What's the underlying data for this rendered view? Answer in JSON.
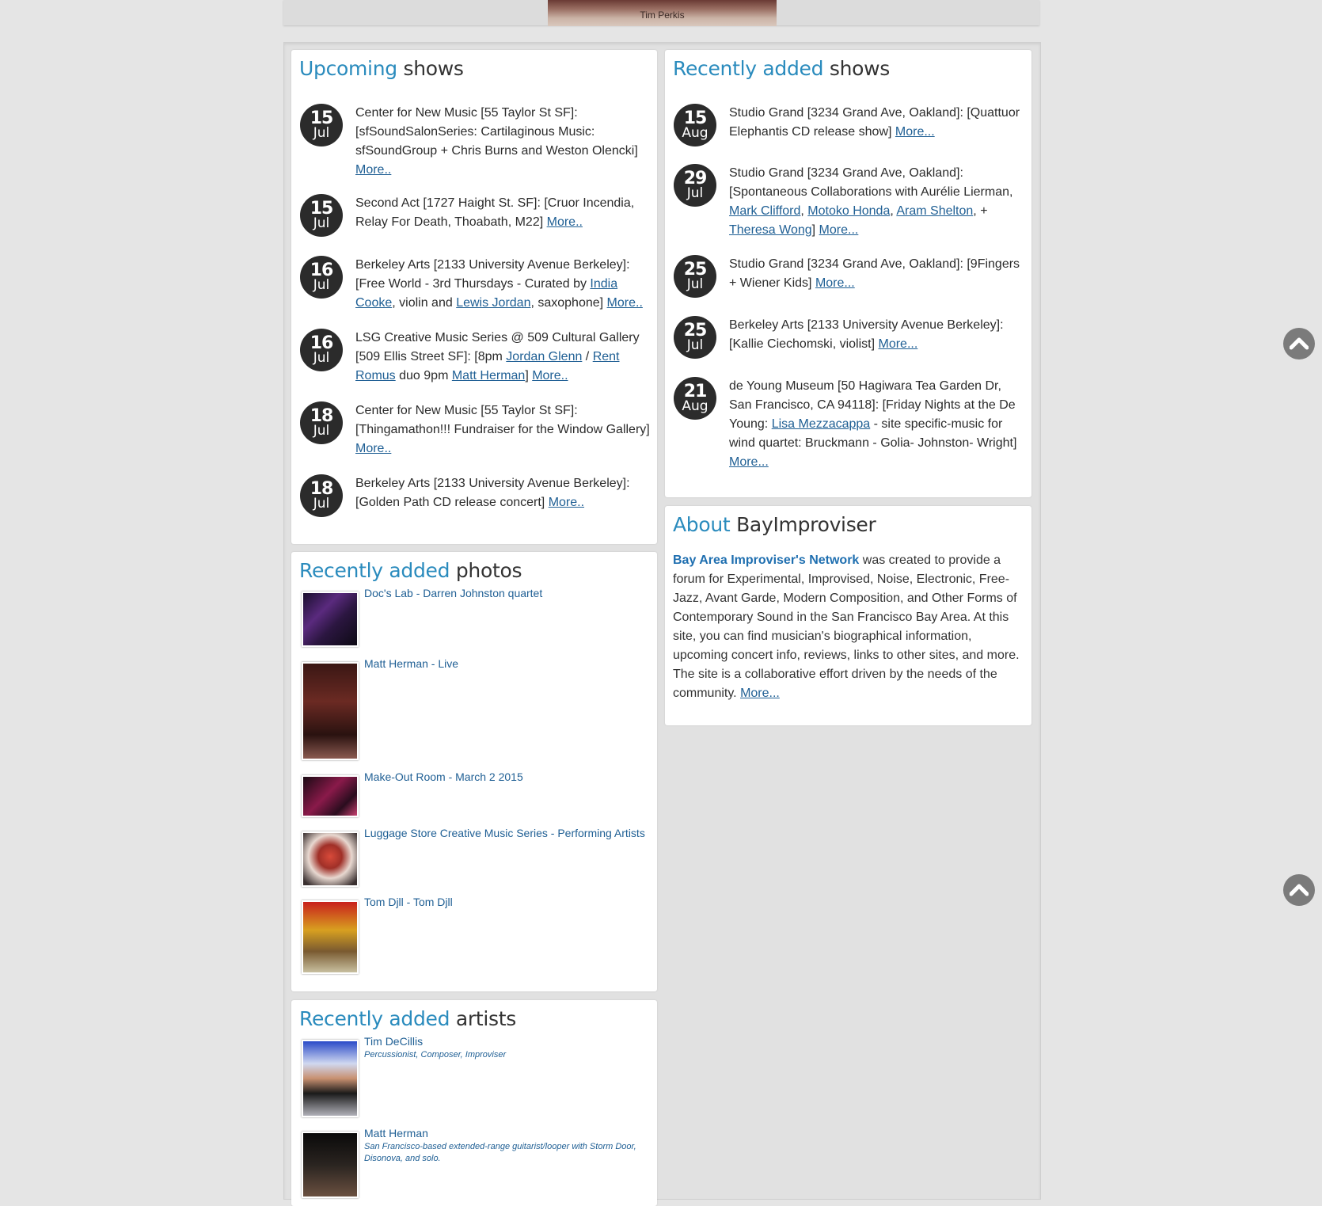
{
  "banner": {
    "caption": "Tim Perkis"
  },
  "upcoming": {
    "title_accent": "Upcoming",
    "title_main": "shows",
    "events": [
      {
        "day": "15",
        "mon": "Jul",
        "text": "Center for New Music [55 Taylor St SF]: [sfSoundSalonSeries: Cartilaginous Music: sfSoundGroup + Chris Burns and Weston Olencki] ",
        "more": "More.."
      },
      {
        "day": "15",
        "mon": "Jul",
        "text": "Second Act [1727 Haight St. SF]: [Cruor Incendia, Relay For Death, Thoabath, M22] ",
        "more": "More.."
      },
      {
        "day": "16",
        "mon": "Jul",
        "t1": "Berkeley Arts [2133 University Avenue Berkeley]: [Free World - 3rd Thursdays - Curated by ",
        "l1": "India Cooke",
        "t2": ", violin and ",
        "l2": "Lewis Jordan",
        "t3": ", saxophone] ",
        "more": "More.."
      },
      {
        "day": "16",
        "mon": "Jul",
        "t1": "LSG Creative Music Series @ 509 Cultural Gallery [509 Ellis Street SF]: [8pm ",
        "l1": "Jordan Glenn",
        "t2": " / ",
        "l2": "Rent Romus",
        "t3": " duo 9pm ",
        "l3": "Matt Herman",
        "t4": "] ",
        "more": "More.."
      },
      {
        "day": "18",
        "mon": "Jul",
        "text": "Center for New Music [55 Taylor St SF]: [Thingamathon!!! Fundraiser for the Window Gallery] ",
        "more": "More.."
      },
      {
        "day": "18",
        "mon": "Jul",
        "text": "Berkeley Arts [2133 University Avenue Berkeley]: [Golden Path CD release concert] ",
        "more": "More.."
      }
    ]
  },
  "recent_shows": {
    "title_accent": "Recently added",
    "title_main": "shows",
    "events": [
      {
        "day": "15",
        "mon": "Aug",
        "text": "Studio Grand [3234 Grand Ave, Oakland]: [Quattuor Elephantis CD release show] ",
        "more": "More..."
      },
      {
        "day": "29",
        "mon": "Jul",
        "t1": "Studio Grand [3234 Grand Ave, Oakland]: [Spontaneous Collaborations with Aurélie Lierman, ",
        "l1": "Mark Clifford",
        "t2": ", ",
        "l2": "Motoko Honda",
        "t3": ", ",
        "l3": "Aram Shelton",
        "t4": ", + ",
        "l4": "Theresa Wong",
        "t5": "] ",
        "more": "More..."
      },
      {
        "day": "25",
        "mon": "Jul",
        "text": "Studio Grand [3234 Grand Ave, Oakland]: [9Fingers + Wiener Kids] ",
        "more": "More..."
      },
      {
        "day": "25",
        "mon": "Jul",
        "text": "Berkeley Arts [2133 University Avenue Berkeley]: [Kallie Ciechomski, violist] ",
        "more": "More..."
      },
      {
        "day": "21",
        "mon": "Aug",
        "t1": "de Young Museum [50 Hagiwara Tea Garden Dr, San Francisco, CA 94118]: [Friday Nights at the De Young: ",
        "l1": "Lisa Mezzacappa",
        "t2": " - site specific-music for wind quartet: Bruckmann - Golia- Johnston- Wright] ",
        "more": "More..."
      }
    ]
  },
  "photos": {
    "title_accent": "Recently added",
    "title_main": "photos",
    "items": [
      {
        "title": "Doc's Lab - Darren Johnston quartet"
      },
      {
        "title": "Matt Herman - Live"
      },
      {
        "title": "Make-Out Room - March 2 2015"
      },
      {
        "title": "Luggage Store Creative Music Series - Performing Artists"
      },
      {
        "title": "Tom Djll - Tom Djll"
      }
    ]
  },
  "about": {
    "title_accent": "About",
    "title_main": "BayImproviser",
    "org": "Bay Area Improviser's Network",
    "body": " was created to provide a forum for Experimental, Improvised, Noise, Electronic, Free-Jazz, Avant Garde, Modern Composition, and Other Forms of Contemporary Sound in the San Francisco Bay Area. At this site, you can find musician's biographical information, upcoming concert info, reviews, links to other sites, and more. The site is a collaborative effort driven by the needs of the community.  ",
    "more": "More..."
  },
  "artists": {
    "title_accent": "Recently added",
    "title_main": "artists",
    "items": [
      {
        "name": "Tim DeCillis",
        "desc": "Percussionist, Composer, Improviser"
      },
      {
        "name": "Matt Herman",
        "desc": "San Francisco-based extended-range guitarist/looper with Storm Door, Disonova, and solo."
      }
    ]
  }
}
